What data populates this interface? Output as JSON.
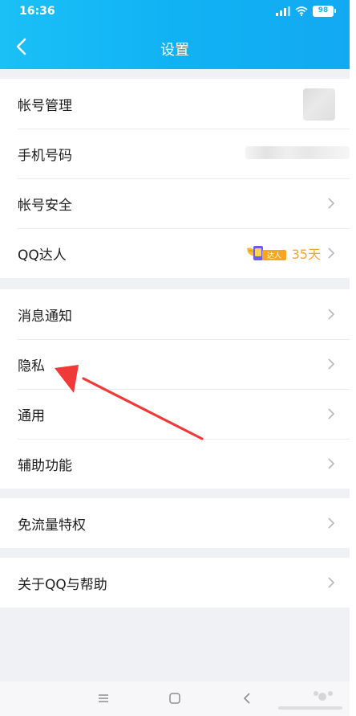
{
  "status_bar": {
    "time": "16:36",
    "battery": "98"
  },
  "header": {
    "title": "设置"
  },
  "groups": [
    {
      "items": [
        {
          "label": "帐号管理"
        },
        {
          "label": "手机号码"
        },
        {
          "label": "帐号安全"
        },
        {
          "label": "QQ达人",
          "badge_text": "达人",
          "days": "35天"
        }
      ]
    },
    {
      "items": [
        {
          "label": "消息通知"
        },
        {
          "label": "隐私"
        },
        {
          "label": "通用"
        },
        {
          "label": "辅助功能"
        }
      ]
    },
    {
      "items": [
        {
          "label": "免流量特权"
        }
      ]
    },
    {
      "items": [
        {
          "label": "关于QQ与帮助"
        }
      ]
    }
  ],
  "colors": {
    "header": "#12b2f4",
    "annotation_arrow": "#f03a3a",
    "daren_orange": "#f5a623"
  }
}
